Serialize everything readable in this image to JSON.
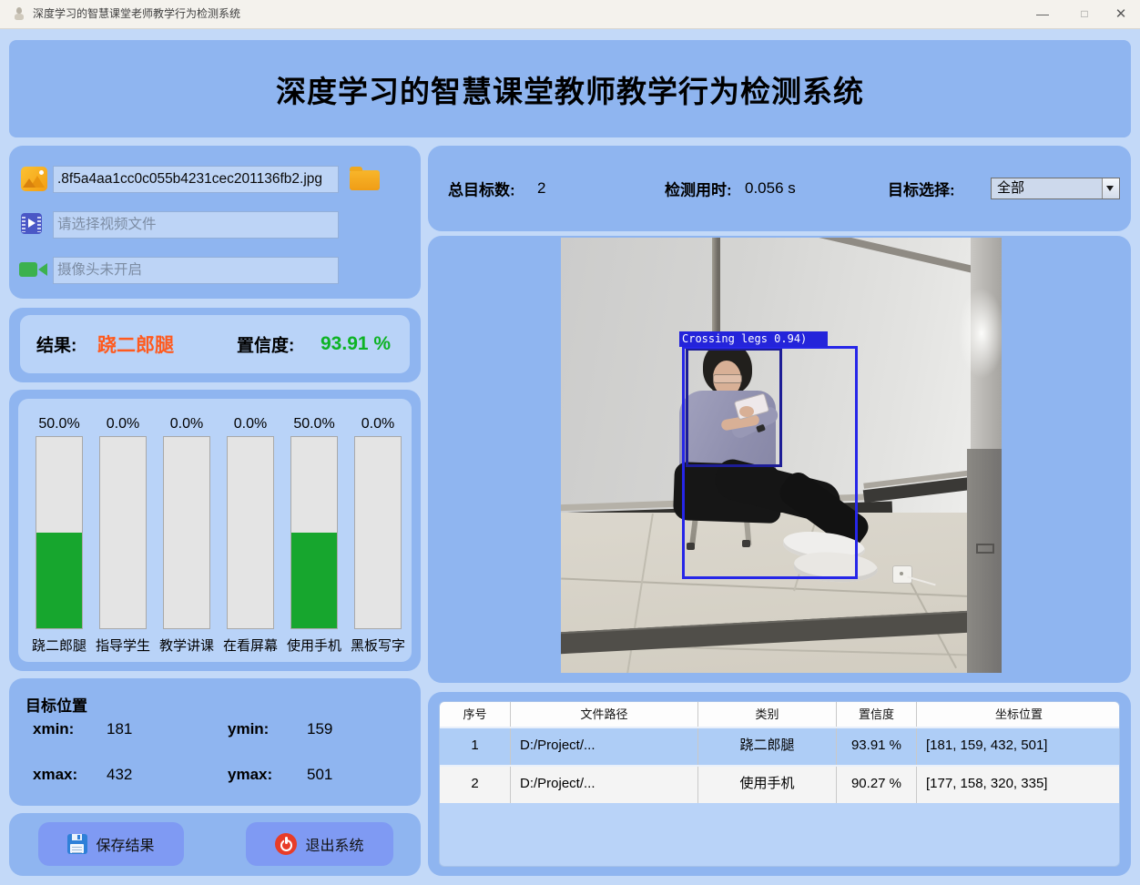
{
  "colors": {
    "background_blue": "#c3d9f8",
    "panel_blue": "#8fb5f0",
    "panel_light_blue": "#b9d3f8",
    "button_blue": "#7f9af3",
    "result_orange": "#ff5a1e",
    "confidence_green": "#0db324",
    "bar_green": "#17a62e",
    "detection_box_blue": "#2626e8",
    "titlebar_bg": "#f4f2ed"
  },
  "window": {
    "title": "深度学习的智慧课堂老师教学行为检测系统",
    "minimize_glyph": "—",
    "maximize_glyph": "□",
    "close_glyph": "✕"
  },
  "header": {
    "title": "深度学习的智慧课堂教师教学行为检测系统"
  },
  "file_inputs": {
    "image_path": ".8f5a4aa1cc0c055b4231cec201136fb2.jpg",
    "video_placeholder": "请选择视频文件",
    "camera_placeholder": "摄像头未开启"
  },
  "result": {
    "label": "结果:",
    "value": "跷二郎腿",
    "confidence_label": "置信度:",
    "confidence": "93.91 %"
  },
  "chart_data": {
    "type": "bar",
    "categories": [
      "跷二郎腿",
      "指导学生",
      "教学讲课",
      "在看屏幕",
      "使用手机",
      "黑板写字"
    ],
    "values": [
      50.0,
      0.0,
      0.0,
      0.0,
      50.0,
      0.0
    ],
    "value_labels": [
      "50.0%",
      "0.0%",
      "0.0%",
      "0.0%",
      "50.0%",
      "0.0%"
    ],
    "ylim": [
      0,
      100
    ],
    "bar_color": "#17a62e"
  },
  "position": {
    "title": "目标位置",
    "xmin_label": "xmin:",
    "xmin": "181",
    "ymin_label": "ymin:",
    "ymin": "159",
    "xmax_label": "xmax:",
    "xmax": "432",
    "ymax_label": "ymax:",
    "ymax": "501"
  },
  "actions": {
    "save": "保存结果",
    "exit": "退出系统"
  },
  "stats": {
    "total_label": "总目标数:",
    "total": "2",
    "time_label": "检测用时:",
    "time": "0.056 s",
    "select_label": "目标选择:",
    "selected": "全部"
  },
  "viewer": {
    "detection_label": "Crossing legs 0.94)"
  },
  "table": {
    "headers": [
      "序号",
      "文件路径",
      "类别",
      "置信度",
      "坐标位置"
    ],
    "rows": [
      [
        "1",
        "D:/Project/...",
        "跷二郎腿",
        "93.91 %",
        "[181, 159, 432, 501]"
      ],
      [
        "2",
        "D:/Project/...",
        "使用手机",
        "90.27 %",
        "[177, 158, 320, 335]"
      ]
    ]
  }
}
